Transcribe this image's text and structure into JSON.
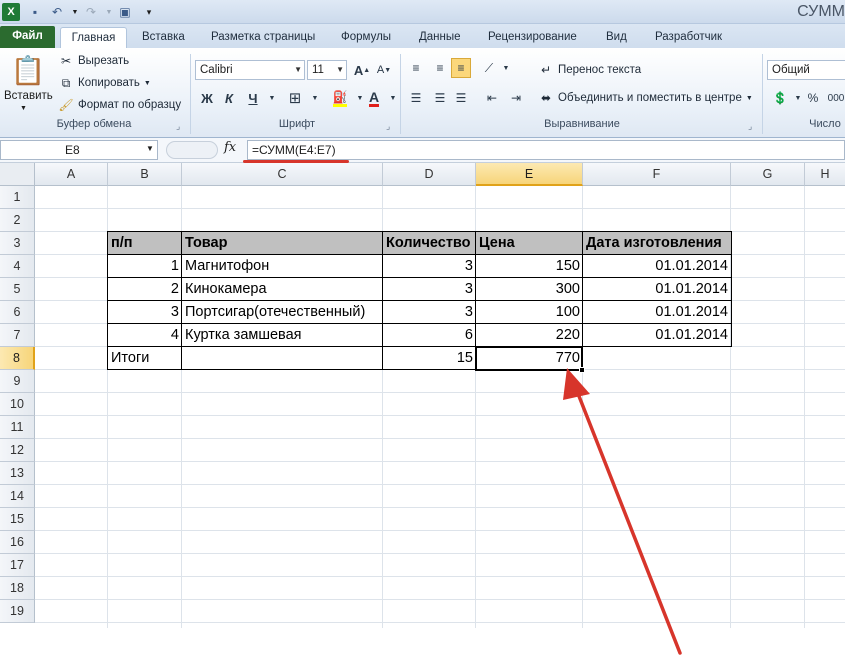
{
  "window": {
    "title": "СУММ"
  },
  "ribbon_tabs": [
    "Файл",
    "Главная",
    "Вставка",
    "Разметка страницы",
    "Формулы",
    "Данные",
    "Рецензирование",
    "Вид",
    "Разработчик"
  ],
  "clipboard": {
    "paste": "Вставить",
    "cut": "Вырезать",
    "copy": "Копировать",
    "format_painter": "Формат по образцу",
    "title": "Буфер обмена"
  },
  "font": {
    "name": "Calibri",
    "size": "11",
    "bold": "Ж",
    "italic": "К",
    "underline": "Ч",
    "title": "Шрифт"
  },
  "alignment": {
    "wrap_text": "Перенос текста",
    "merge_center": "Объединить и поместить в центре",
    "title": "Выравнивание"
  },
  "number": {
    "format": "Общий",
    "percent": "%",
    "thousands": "000",
    "title": "Число"
  },
  "formula_bar": {
    "name_box": "E8",
    "fx": "fx",
    "formula": "=СУММ(E4:E7)"
  },
  "columns": [
    "A",
    "B",
    "C",
    "D",
    "E",
    "F",
    "G",
    "H"
  ],
  "rows": [
    "1",
    "2",
    "3",
    "4",
    "5",
    "6",
    "7",
    "8",
    "9",
    "10",
    "11",
    "12",
    "13",
    "14",
    "15",
    "16",
    "17",
    "18",
    "19"
  ],
  "active_cell": "E8",
  "colors": {
    "annotation": "#d7352b",
    "header_fill": "#c0c0c0",
    "file_tab": "#2b6b2f"
  },
  "table": {
    "headers": [
      "п/п",
      "Товар",
      "Количество",
      "Цена",
      "Дата изготовления"
    ],
    "rows": [
      [
        "1",
        "Магнитофон",
        "3",
        "150",
        "01.01.2014"
      ],
      [
        "2",
        "Кинокамера",
        "3",
        "300",
        "01.01.2014"
      ],
      [
        "3",
        "Портсигар(отечественный)",
        "3",
        "100",
        "01.01.2014"
      ],
      [
        "4",
        "Куртка замшевая",
        "6",
        "220",
        "01.01.2014"
      ]
    ],
    "totals": {
      "label": "Итоги",
      "quantity": "15",
      "price": "770"
    }
  }
}
